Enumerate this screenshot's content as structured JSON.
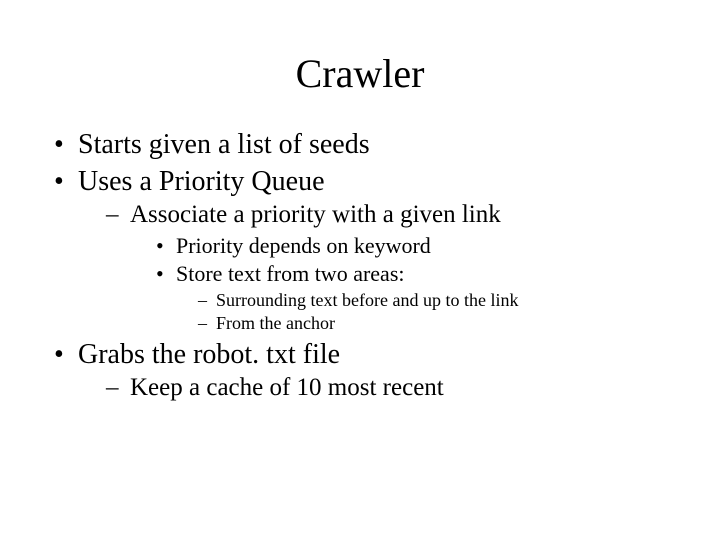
{
  "title": "Crawler",
  "bullets": {
    "b1": "Starts given a list of seeds",
    "b2": "Uses a Priority Queue",
    "b2_1": "Associate a priority with a given link",
    "b2_1_1": "Priority depends on keyword",
    "b2_1_2": "Store text from two areas:",
    "b2_1_2_1": "Surrounding text before and up to the link",
    "b2_1_2_2": "From the anchor",
    "b3": "Grabs the robot. txt file",
    "b3_1": "Keep a cache of 10 most recent"
  }
}
